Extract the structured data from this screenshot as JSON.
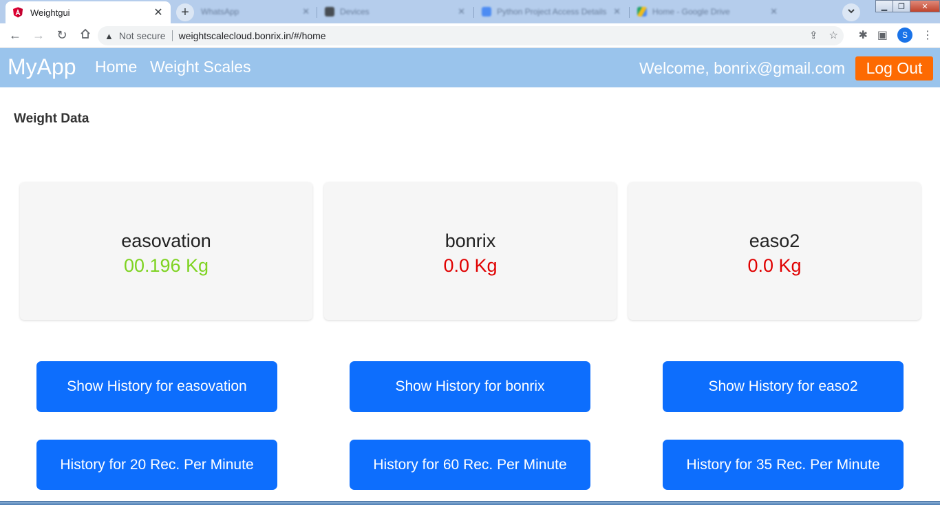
{
  "browser": {
    "active_tab": {
      "title": "Weightgui",
      "favicon": "angular-icon"
    },
    "background_tabs": [
      {
        "title": "WhatsApp"
      },
      {
        "title": "Devices"
      },
      {
        "title": "Python Project Access Details"
      },
      {
        "title": "Home - Google Drive"
      }
    ],
    "security_label": "Not secure",
    "url": "weightscalecloud.bonrix.in/#/home",
    "profile_initial": "S"
  },
  "appbar": {
    "brand": "MyApp",
    "nav": [
      {
        "label": "Home"
      },
      {
        "label": "Weight Scales"
      }
    ],
    "welcome": "Welcome, bonrix@gmail.com",
    "logout_label": "Log Out",
    "colors": {
      "bar": "#9ac4ec",
      "logout": "#fd6a02"
    }
  },
  "content": {
    "title": "Weight Data",
    "scales": [
      {
        "name": "easovation",
        "weight": "00.196 Kg",
        "weight_color": "#7ed321",
        "history_label": "Show History for easovation",
        "rate_label": "History for 20 Rec. Per Minute"
      },
      {
        "name": "bonrix",
        "weight": "0.0 Kg",
        "weight_color": "#e00000",
        "history_label": "Show History for bonrix",
        "rate_label": "History for 60 Rec. Per Minute"
      },
      {
        "name": "easo2",
        "weight": "0.0 Kg",
        "weight_color": "#e00000",
        "history_label": "Show History for easo2",
        "rate_label": "History for 35 Rec. Per Minute"
      }
    ],
    "colors": {
      "button": "#0d6efd"
    }
  }
}
